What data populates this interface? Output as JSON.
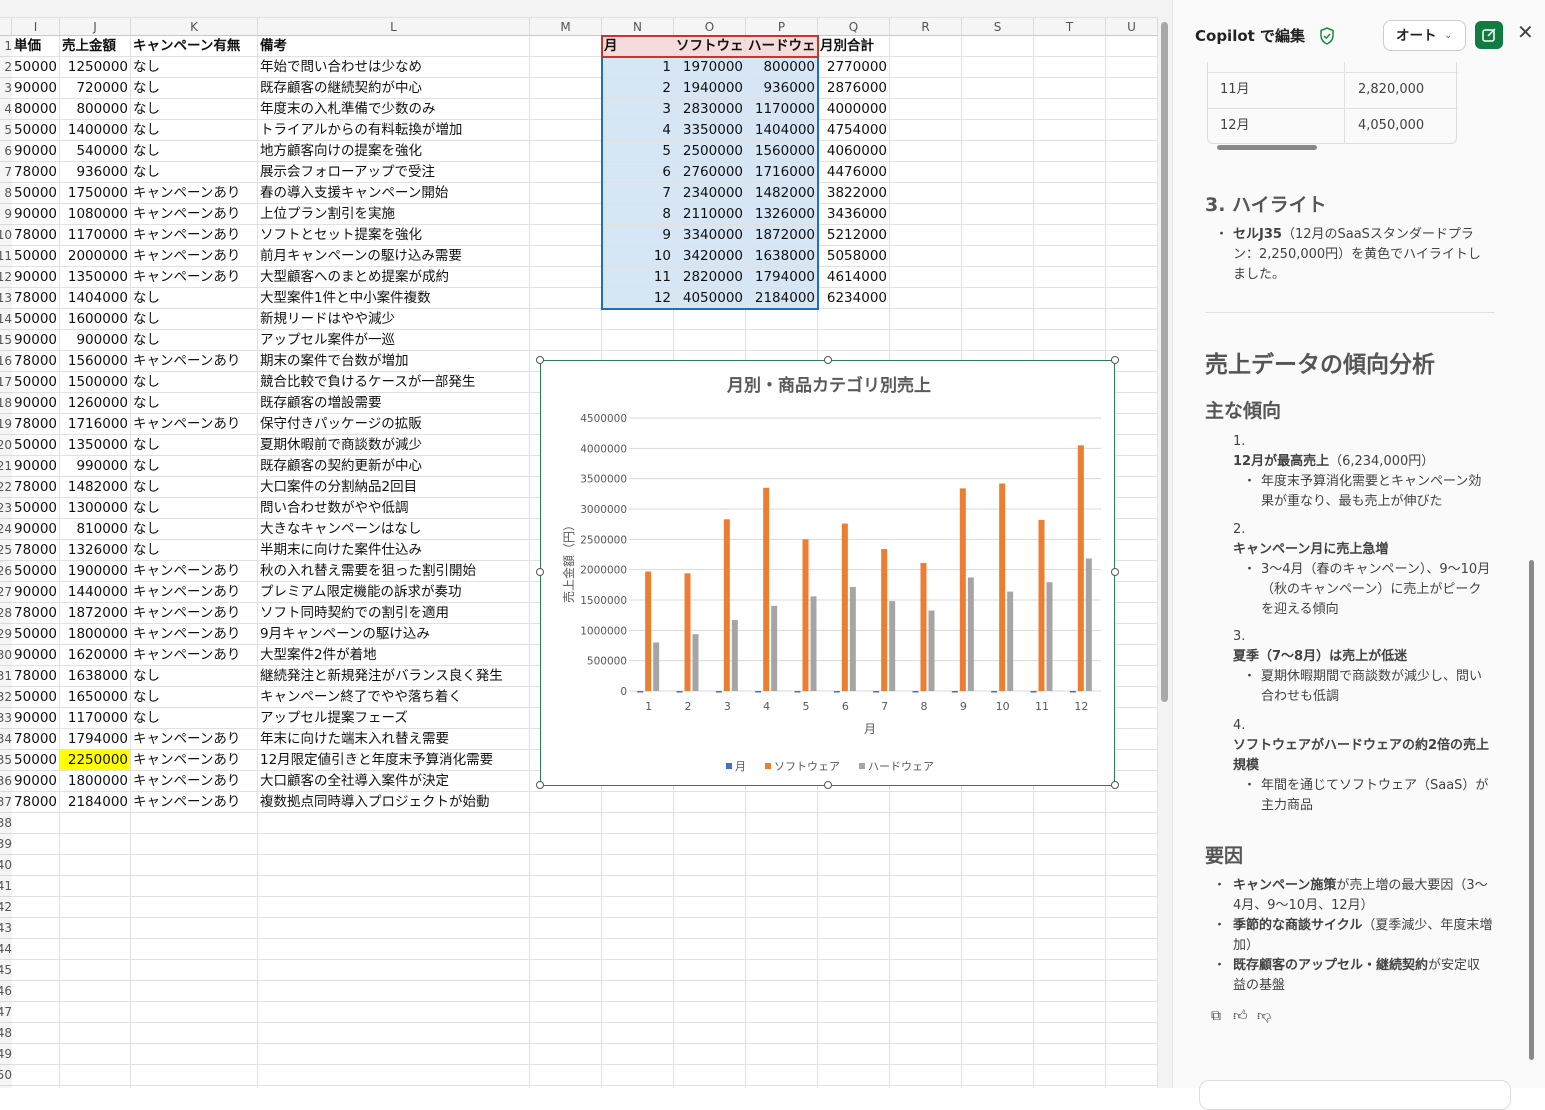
{
  "sheet": {
    "columns": [
      "I",
      "J",
      "K",
      "L",
      "M",
      "N",
      "O",
      "P",
      "Q",
      "R",
      "S",
      "T",
      "U"
    ],
    "headers": {
      "I": "単価",
      "J": "売上金額",
      "K": "キャンペーン有無",
      "L": "備考",
      "N": "月",
      "O": "ソフトウェア",
      "P": "ハードウェア",
      "Q": "月別合計"
    },
    "rows": [
      [
        "50000",
        "1250000",
        "なし",
        "年始で問い合わせは少なめ"
      ],
      [
        "90000",
        "720000",
        "なし",
        "既存顧客の継続契約が中心"
      ],
      [
        "80000",
        "800000",
        "なし",
        "年度末の入札準備で少数のみ"
      ],
      [
        "50000",
        "1400000",
        "なし",
        "トライアルからの有料転換が増加"
      ],
      [
        "90000",
        "540000",
        "なし",
        "地方顧客向けの提案を強化"
      ],
      [
        "78000",
        "936000",
        "なし",
        "展示会フォローアップで受注"
      ],
      [
        "50000",
        "1750000",
        "キャンペーンあり",
        "春の導入支援キャンペーン開始"
      ],
      [
        "90000",
        "1080000",
        "キャンペーンあり",
        "上位プラン割引を実施"
      ],
      [
        "78000",
        "1170000",
        "キャンペーンあり",
        "ソフトとセット提案を強化"
      ],
      [
        "50000",
        "2000000",
        "キャンペーンあり",
        "前月キャンペーンの駆け込み需要"
      ],
      [
        "90000",
        "1350000",
        "キャンペーンあり",
        "大型顧客へのまとめ提案が成約"
      ],
      [
        "78000",
        "1404000",
        "なし",
        "大型案件1件と中小案件複数"
      ],
      [
        "50000",
        "1600000",
        "なし",
        "新規リードはやや減少"
      ],
      [
        "90000",
        "900000",
        "なし",
        "アップセル案件が一巡"
      ],
      [
        "78000",
        "1560000",
        "キャンペーンあり",
        "期末の案件で台数が増加"
      ],
      [
        "50000",
        "1500000",
        "なし",
        "競合比較で負けるケースが一部発生"
      ],
      [
        "90000",
        "1260000",
        "なし",
        "既存顧客の増設需要"
      ],
      [
        "78000",
        "1716000",
        "キャンペーンあり",
        "保守付きパッケージの拡販"
      ],
      [
        "50000",
        "1350000",
        "なし",
        "夏期休暇前で商談数が減少"
      ],
      [
        "90000",
        "990000",
        "なし",
        "既存顧客の契約更新が中心"
      ],
      [
        "78000",
        "1482000",
        "なし",
        "大口案件の分割納品2回目"
      ],
      [
        "50000",
        "1300000",
        "なし",
        "問い合わせ数がやや低調"
      ],
      [
        "90000",
        "810000",
        "なし",
        "大きなキャンペーンはなし"
      ],
      [
        "78000",
        "1326000",
        "なし",
        "半期末に向けた案件仕込み"
      ],
      [
        "50000",
        "1900000",
        "キャンペーンあり",
        "秋の入れ替え需要を狙った割引開始"
      ],
      [
        "90000",
        "1440000",
        "キャンペーンあり",
        "プレミアム限定機能の訴求が奏功"
      ],
      [
        "78000",
        "1872000",
        "キャンペーンあり",
        "ソフト同時契約での割引を適用"
      ],
      [
        "50000",
        "1800000",
        "キャンペーンあり",
        "9月キャンペーンの駆け込み"
      ],
      [
        "90000",
        "1620000",
        "キャンペーンあり",
        "大型案件2件が着地"
      ],
      [
        "78000",
        "1638000",
        "なし",
        "継続発注と新規発注がバランス良く発生"
      ],
      [
        "50000",
        "1650000",
        "なし",
        "キャンペーン終了でやや落ち着く"
      ],
      [
        "90000",
        "1170000",
        "なし",
        "アップセル提案フェーズ"
      ],
      [
        "78000",
        "1794000",
        "キャンペーンあり",
        "年末に向けた端末入れ替え需要"
      ],
      [
        "50000",
        "2250000",
        "キャンペーンあり",
        "12月限定値引きと年度末予算消化需要"
      ],
      [
        "90000",
        "1800000",
        "キャンペーンあり",
        "大口顧客の全社導入案件が決定"
      ],
      [
        "78000",
        "2184000",
        "キャンペーンあり",
        "複数拠点同時導入プロジェクトが始動"
      ]
    ],
    "highlight_row": 35,
    "highlight_color": "#ffff00",
    "summary": [
      [
        "1",
        "1970000",
        "800000",
        "2770000"
      ],
      [
        "2",
        "1940000",
        "936000",
        "2876000"
      ],
      [
        "3",
        "2830000",
        "1170000",
        "4000000"
      ],
      [
        "4",
        "3350000",
        "1404000",
        "4754000"
      ],
      [
        "5",
        "2500000",
        "1560000",
        "4060000"
      ],
      [
        "6",
        "2760000",
        "1716000",
        "4476000"
      ],
      [
        "7",
        "2340000",
        "1482000",
        "3822000"
      ],
      [
        "8",
        "2110000",
        "1326000",
        "3436000"
      ],
      [
        "9",
        "3340000",
        "1872000",
        "5212000"
      ],
      [
        "10",
        "3420000",
        "1638000",
        "5058000"
      ],
      [
        "11",
        "2820000",
        "1794000",
        "4614000"
      ],
      [
        "12",
        "4050000",
        "2184000",
        "6234000"
      ]
    ]
  },
  "chart_data": {
    "type": "bar",
    "title": "月別・商品カテゴリ別売上",
    "xlabel": "月",
    "ylabel": "売上金額（円）",
    "categories": [
      "1",
      "2",
      "3",
      "4",
      "5",
      "6",
      "7",
      "8",
      "9",
      "10",
      "11",
      "12"
    ],
    "series": [
      {
        "name": "月",
        "color": "#4472c4",
        "values": [
          1,
          2,
          3,
          4,
          5,
          6,
          7,
          8,
          9,
          10,
          11,
          12
        ]
      },
      {
        "name": "ソフトウェア",
        "color": "#ed7d31",
        "values": [
          1970000,
          1940000,
          2830000,
          3350000,
          2500000,
          2760000,
          2340000,
          2110000,
          3340000,
          3420000,
          2820000,
          4050000
        ]
      },
      {
        "name": "ハードウェア",
        "color": "#a5a5a5",
        "values": [
          800000,
          936000,
          1170000,
          1404000,
          1560000,
          1716000,
          1482000,
          1326000,
          1872000,
          1638000,
          1794000,
          2184000
        ]
      }
    ],
    "ylim": [
      0,
      4500000
    ],
    "yticks": [
      "0",
      "500000",
      "1000000",
      "1500000",
      "2000000",
      "2500000",
      "3000000",
      "3500000",
      "4000000",
      "4500000"
    ],
    "grid": true,
    "legend": "bottom"
  },
  "copilot": {
    "title": "Copilot で編集",
    "mode": "オート",
    "table_rows": [
      [
        "11月",
        "2,820,000"
      ],
      [
        "12月",
        "4,050,000"
      ]
    ],
    "h3": "3. ハイライト",
    "highlight_bold": "セルJ35",
    "highlight_text": "（12月のSaaSスタンダードプラン：2,250,000円）を黄色でハイライトしました。",
    "h_analysis": "売上データの傾向分析",
    "h_trends": "主な傾向",
    "trends": [
      {
        "num": "1.",
        "title": "12月が最高売上",
        "title_suffix": "（6,234,000円）",
        "detail": "年度末予算消化需要とキャンペーン効果が重なり、最も売上が伸びた"
      },
      {
        "num": "2.",
        "title": "キャンペーン月に売上急増",
        "title_suffix": "",
        "detail": "3〜4月（春のキャンペーン）、9〜10月（秋のキャンペーン）に売上がピークを迎える傾向"
      },
      {
        "num": "3.",
        "title": "夏季（7〜8月）は売上が低迷",
        "title_suffix": "",
        "detail": "夏期休暇期間で商談数が減少し、問い合わせも低調"
      },
      {
        "num": "4.",
        "title": "ソフトウェアがハードウェアの約2倍の売上規模",
        "title_suffix": "",
        "detail": "年間を通じてソフトウェア（SaaS）が主力商品"
      }
    ],
    "h_factors": "要因",
    "factors": [
      {
        "bold": "キャンペーン施策",
        "text": "が売上増の最大要因（3〜4月、9〜10月、12月）"
      },
      {
        "bold": "季節的な商談サイクル",
        "text": "（夏季減少、年度末増加）"
      },
      {
        "bold": "既存顧客のアップセル・継続契約",
        "text": "が安定収益の基盤"
      }
    ]
  }
}
